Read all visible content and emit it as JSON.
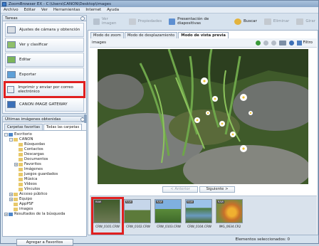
{
  "window": {
    "title": "ZoomBrowser EX  -  C:\\Users\\CANON\\Desktop\\images"
  },
  "menu": [
    "Archivo",
    "Editar",
    "Ver",
    "Herramientas",
    "Internet",
    "Ayuda"
  ],
  "toolbar": [
    {
      "label": "Ver imagen",
      "enabled": false,
      "icon": "view-image-icon"
    },
    {
      "label": "Propiedades",
      "enabled": false,
      "icon": "properties-icon"
    },
    {
      "label": "Presentación de diapositivas",
      "enabled": true,
      "icon": "slideshow-icon"
    },
    {
      "label": "Buscar",
      "enabled": true,
      "icon": "search-icon"
    },
    {
      "label": "Eliminar",
      "enabled": false,
      "icon": "delete-icon"
    },
    {
      "label": "Girar",
      "enabled": false,
      "icon": "rotate-icon"
    }
  ],
  "tasks": {
    "header": "Tareas",
    "items": [
      {
        "label": "Ajustes de cámara y obtención",
        "icon": "camera-icon"
      },
      {
        "label": "Ver y clasificar",
        "icon": "view-classify-icon"
      },
      {
        "label": "Editar",
        "icon": "edit-icon"
      },
      {
        "label": "Exportar",
        "icon": "export-icon"
      },
      {
        "label": "Imprimir y enviar por correo electrónico",
        "icon": "print-email-icon",
        "highlighted": true
      },
      {
        "label": "CANON iMAGE GATEWAY",
        "icon": "gateway-icon"
      }
    ]
  },
  "recent": {
    "header": "Últimas imágenes obtenidas",
    "tabs": [
      {
        "label": "Carpetas favoritas",
        "active": false
      },
      {
        "label": "Todas las carpetas",
        "active": true
      }
    ],
    "tree": [
      {
        "label": "Escritorio",
        "level": 0,
        "expand": "-"
      },
      {
        "label": "CANON",
        "level": 1,
        "expand": "-"
      },
      {
        "label": "Búsquedas",
        "level": 2,
        "expand": ""
      },
      {
        "label": "Contactos",
        "level": 2,
        "expand": ""
      },
      {
        "label": "Descargas",
        "level": 2,
        "expand": ""
      },
      {
        "label": "Documentos",
        "level": 2,
        "expand": ""
      },
      {
        "label": "Favoritos",
        "level": 2,
        "expand": "+"
      },
      {
        "label": "Imágenes",
        "level": 2,
        "expand": ""
      },
      {
        "label": "Juegos guardados",
        "level": 2,
        "expand": ""
      },
      {
        "label": "Música",
        "level": 2,
        "expand": ""
      },
      {
        "label": "Vídeos",
        "level": 2,
        "expand": ""
      },
      {
        "label": "Vínculos",
        "level": 2,
        "expand": ""
      },
      {
        "label": "Acceso público",
        "level": 1,
        "expand": "+"
      },
      {
        "label": "Equipo",
        "level": 1,
        "expand": "+"
      },
      {
        "label": "AppPSF",
        "level": 1,
        "expand": ""
      },
      {
        "label": "images",
        "level": 1,
        "expand": ""
      },
      {
        "label": "Resultados de la búsqueda",
        "level": 0,
        "expand": "+"
      }
    ],
    "add_favorites": "Agregar a Favoritos"
  },
  "modes": [
    {
      "label": "Modo de zoom",
      "active": false
    },
    {
      "label": "Modo de desplazamiento",
      "active": false
    },
    {
      "label": "Modo de vista previa",
      "active": true
    }
  ],
  "imagebar": {
    "label": "images",
    "filter": "Filtro"
  },
  "nav": {
    "prev": "< Anterior",
    "next": "Siguiente >"
  },
  "thumbnails": [
    {
      "caption": "CRW_0101.CRW",
      "badge": "RAW",
      "selected": true
    },
    {
      "caption": "CRW_0102.CRW",
      "badge": "RAW",
      "selected": false
    },
    {
      "caption": "CRW_0103.CRW",
      "badge": "RAW",
      "selected": false
    },
    {
      "caption": "CRW_0104.CRW",
      "badge": "RAW",
      "selected": false
    },
    {
      "caption": "IMG_0634.CR2",
      "badge": "RAW",
      "selected": false
    }
  ],
  "status": "Elementos seleccionados: 0"
}
